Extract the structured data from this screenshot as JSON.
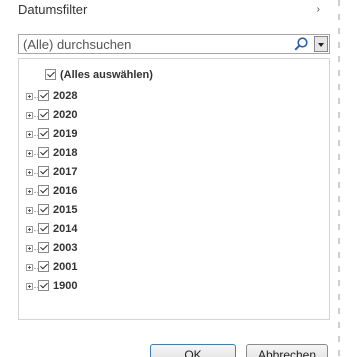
{
  "header": {
    "title": "Datumsfilter",
    "arrow": "›"
  },
  "search": {
    "placeholder": "(Alle) durchsuchen",
    "value": ""
  },
  "tree": {
    "select_all_label": "(Alles auswählen)",
    "items": [
      {
        "label": "2028",
        "checked": true
      },
      {
        "label": "2020",
        "checked": true
      },
      {
        "label": "2019",
        "checked": true
      },
      {
        "label": "2018",
        "checked": true
      },
      {
        "label": "2017",
        "checked": true
      },
      {
        "label": "2016",
        "checked": true
      },
      {
        "label": "2015",
        "checked": true
      },
      {
        "label": "2014",
        "checked": true
      },
      {
        "label": "2003",
        "checked": true
      },
      {
        "label": "2001",
        "checked": true
      },
      {
        "label": "1900",
        "checked": true
      }
    ]
  },
  "buttons": {
    "ok_label": "OK",
    "cancel_label": "Abbrechen"
  },
  "colors": {
    "ok_border": "#3c7fb1",
    "text": "#333333"
  }
}
